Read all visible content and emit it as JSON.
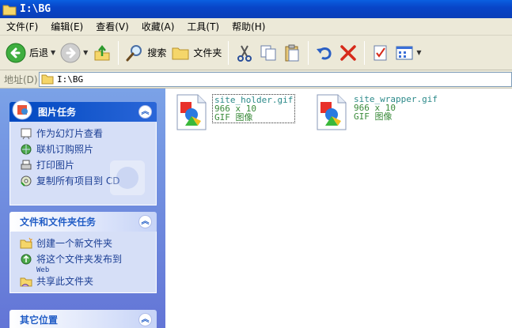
{
  "window": {
    "title": "I:\\BG"
  },
  "menu": [
    "文件(F)",
    "编辑(E)",
    "查看(V)",
    "收藏(A)",
    "工具(T)",
    "帮助(H)"
  ],
  "toolbar": {
    "back_label": "后退",
    "search_label": "搜索",
    "folders_label": "文件夹"
  },
  "address": {
    "label": "地址(D)",
    "value": "I:\\BG"
  },
  "panels": {
    "picture_tasks": {
      "title": "图片任务",
      "items": [
        "作为幻灯片查看",
        "联机订购照片",
        "打印图片",
        "复制所有项目到 CD"
      ]
    },
    "file_folder_tasks": {
      "title": "文件和文件夹任务",
      "items": [
        "创建一个新文件夹",
        "将这个文件夹发布到",
        "Web",
        "共享此文件夹"
      ]
    },
    "other_places": {
      "title": "其它位置"
    }
  },
  "files": [
    {
      "name": "site_holder.gif",
      "dims": "966 x 10",
      "type": "GIF 图像"
    },
    {
      "name": "site_wrapper.gif",
      "dims": "966 x 10",
      "type": "GIF 图像"
    }
  ]
}
